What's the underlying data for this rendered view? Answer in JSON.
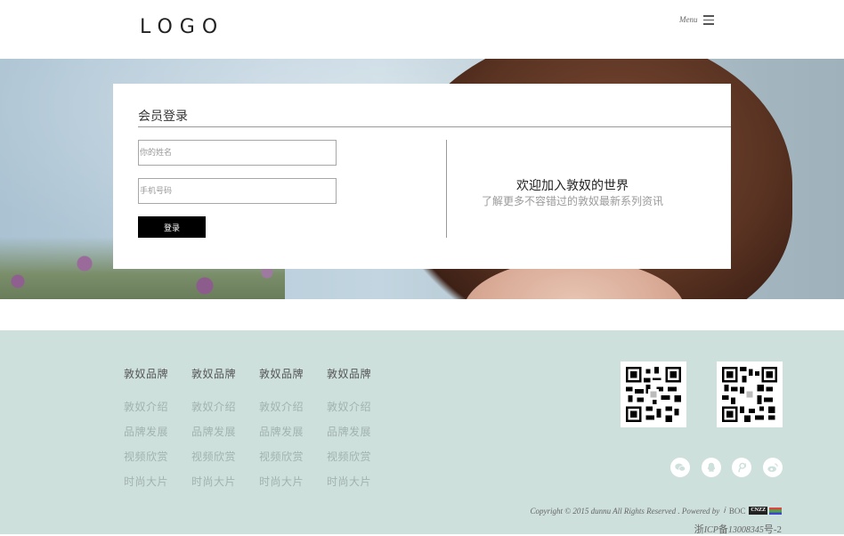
{
  "header": {
    "logo": "LOGO",
    "menu_label": "Menu"
  },
  "login": {
    "title": "会员登录",
    "name_placeholder": "你的姓名",
    "phone_placeholder": "手机号码",
    "submit_label": "登录",
    "welcome_title": "欢迎加入敦奴的世界",
    "welcome_subtitle": "了解更多不容错过的敦奴最新系列资讯"
  },
  "footer": {
    "columns": [
      {
        "heading": "敦奴品牌",
        "links": [
          "敦奴介绍",
          "品牌发展",
          "视频欣赏",
          "时尚大片"
        ]
      },
      {
        "heading": "敦奴品牌",
        "links": [
          "敦奴介绍",
          "品牌发展",
          "视频欣赏",
          "时尚大片"
        ]
      },
      {
        "heading": "敦奴品牌",
        "links": [
          "敦奴介绍",
          "品牌发展",
          "视频欣赏",
          "时尚大片"
        ]
      },
      {
        "heading": "敦奴品牌",
        "links": [
          "敦奴介绍",
          "品牌发展",
          "视频欣赏",
          "时尚大片"
        ]
      }
    ],
    "qr_codes": [
      "qr-code-icon",
      "qr-code-icon"
    ],
    "social_icons": [
      "wechat-icon",
      "qq-icon",
      "tencent-weibo-icon",
      "sina-weibo-icon"
    ],
    "copyright": "Copyright © 2015 dunnu All Rights Reserved . Powered by",
    "powered_by_mark": "ⅰ",
    "boc": "BOC",
    "cnzz": "CNZZ",
    "icp_prefix": "浙",
    "icp_italic": "ICP",
    "icp_mid": "备",
    "icp_number": "13008345",
    "icp_suffix": "号-2"
  },
  "colors": {
    "footer_bg": "#cde0dc",
    "button_bg": "#000000",
    "link_muted": "#a2b2af"
  }
}
